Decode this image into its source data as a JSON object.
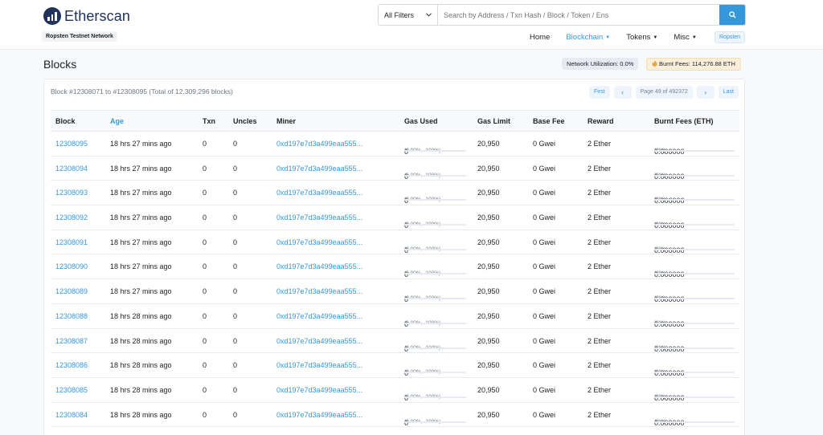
{
  "header": {
    "logo_text": "Etherscan",
    "network_label": "Ropsten Testnet Network",
    "search": {
      "filter_label": "All Filters",
      "placeholder": "Search by Address / Txn Hash / Block / Token / Ens"
    },
    "nav": [
      {
        "label": "Home",
        "active": false,
        "dropdown": false
      },
      {
        "label": "Blockchain",
        "active": true,
        "dropdown": true
      },
      {
        "label": "Tokens",
        "active": false,
        "dropdown": true
      },
      {
        "label": "Misc",
        "active": false,
        "dropdown": true
      }
    ],
    "network_button": "Ropsten"
  },
  "page": {
    "title": "Blocks",
    "network_utilization": "Network Utilization: 0.0%",
    "burnt_fees": "Burnt Fees: 114,276.88 ETH"
  },
  "table": {
    "range_text": "Block #12308071 to #12308095 (Total of 12,309,296 blocks)",
    "pagination": {
      "first": "First",
      "prev": "‹",
      "page_info": "Page 49 of 492372",
      "next": "›",
      "last": "Last"
    },
    "columns": [
      "Block",
      "Age",
      "Txn",
      "Uncles",
      "Miner",
      "Gas Used",
      "Gas Limit",
      "Base Fee",
      "Reward",
      "Burnt Fees (ETH)"
    ],
    "rows": [
      {
        "block": "12308095",
        "age": "18 hrs 27 mins ago",
        "txn": "0",
        "uncles": "0",
        "miner": "0xd197e7d3a499eaa555...",
        "gas_used": "0",
        "gas_pct": "(0.00%, -100%)",
        "gas_limit": "20,950",
        "base_fee": "0 Gwei",
        "reward": "2 Ether",
        "burnt": "0.000000",
        "burnt_pct": "(0%)"
      },
      {
        "block": "12308094",
        "age": "18 hrs 27 mins ago",
        "txn": "0",
        "uncles": "0",
        "miner": "0xd197e7d3a499eaa555...",
        "gas_used": "0",
        "gas_pct": "(0.00%, -100%)",
        "gas_limit": "20,950",
        "base_fee": "0 Gwei",
        "reward": "2 Ether",
        "burnt": "0.000000",
        "burnt_pct": "(0%)"
      },
      {
        "block": "12308093",
        "age": "18 hrs 27 mins ago",
        "txn": "0",
        "uncles": "0",
        "miner": "0xd197e7d3a499eaa555...",
        "gas_used": "0",
        "gas_pct": "(0.00%, -100%)",
        "gas_limit": "20,950",
        "base_fee": "0 Gwei",
        "reward": "2 Ether",
        "burnt": "0.000000",
        "burnt_pct": "(0%)"
      },
      {
        "block": "12308092",
        "age": "18 hrs 27 mins ago",
        "txn": "0",
        "uncles": "0",
        "miner": "0xd197e7d3a499eaa555...",
        "gas_used": "0",
        "gas_pct": "(0.00%, -100%)",
        "gas_limit": "20,950",
        "base_fee": "0 Gwei",
        "reward": "2 Ether",
        "burnt": "0.000000",
        "burnt_pct": "(0%)"
      },
      {
        "block": "12308091",
        "age": "18 hrs 27 mins ago",
        "txn": "0",
        "uncles": "0",
        "miner": "0xd197e7d3a499eaa555...",
        "gas_used": "0",
        "gas_pct": "(0.00%, -100%)",
        "gas_limit": "20,950",
        "base_fee": "0 Gwei",
        "reward": "2 Ether",
        "burnt": "0.000000",
        "burnt_pct": "(0%)"
      },
      {
        "block": "12308090",
        "age": "18 hrs 27 mins ago",
        "txn": "0",
        "uncles": "0",
        "miner": "0xd197e7d3a499eaa555...",
        "gas_used": "0",
        "gas_pct": "(0.00%, -100%)",
        "gas_limit": "20,950",
        "base_fee": "0 Gwei",
        "reward": "2 Ether",
        "burnt": "0.000000",
        "burnt_pct": "(0%)"
      },
      {
        "block": "12308089",
        "age": "18 hrs 27 mins ago",
        "txn": "0",
        "uncles": "0",
        "miner": "0xd197e7d3a499eaa555...",
        "gas_used": "0",
        "gas_pct": "(0.00%, -100%)",
        "gas_limit": "20,950",
        "base_fee": "0 Gwei",
        "reward": "2 Ether",
        "burnt": "0.000000",
        "burnt_pct": "(0%)"
      },
      {
        "block": "12308088",
        "age": "18 hrs 28 mins ago",
        "txn": "0",
        "uncles": "0",
        "miner": "0xd197e7d3a499eaa555...",
        "gas_used": "0",
        "gas_pct": "(0.00%, -100%)",
        "gas_limit": "20,950",
        "base_fee": "0 Gwei",
        "reward": "2 Ether",
        "burnt": "0.000000",
        "burnt_pct": "(0%)"
      },
      {
        "block": "12308087",
        "age": "18 hrs 28 mins ago",
        "txn": "0",
        "uncles": "0",
        "miner": "0xd197e7d3a499eaa555...",
        "gas_used": "0",
        "gas_pct": "(0.00%, -100%)",
        "gas_limit": "20,950",
        "base_fee": "0 Gwei",
        "reward": "2 Ether",
        "burnt": "0.000000",
        "burnt_pct": "(0%)"
      },
      {
        "block": "12308086",
        "age": "18 hrs 28 mins ago",
        "txn": "0",
        "uncles": "0",
        "miner": "0xd197e7d3a499eaa555...",
        "gas_used": "0",
        "gas_pct": "(0.00%, -100%)",
        "gas_limit": "20,950",
        "base_fee": "0 Gwei",
        "reward": "2 Ether",
        "burnt": "0.000000",
        "burnt_pct": "(0%)"
      },
      {
        "block": "12308085",
        "age": "18 hrs 28 mins ago",
        "txn": "0",
        "uncles": "0",
        "miner": "0xd197e7d3a499eaa555...",
        "gas_used": "0",
        "gas_pct": "(0.00%, -100%)",
        "gas_limit": "20,950",
        "base_fee": "0 Gwei",
        "reward": "2 Ether",
        "burnt": "0.000000",
        "burnt_pct": "(0%)"
      },
      {
        "block": "12308084",
        "age": "18 hrs 28 mins ago",
        "txn": "0",
        "uncles": "0",
        "miner": "0xd197e7d3a499eaa555...",
        "gas_used": "0",
        "gas_pct": "(0.00%, -100%)",
        "gas_limit": "20,950",
        "base_fee": "0 Gwei",
        "reward": "2 Ether",
        "burnt": "0.000000",
        "burnt_pct": "(0%)"
      }
    ]
  },
  "colors": {
    "accent": "#3498db",
    "brand_dark": "#21325b",
    "border": "#e7eaf3"
  },
  "icons": {
    "logo": "etherscan-logo-icon",
    "search": "search-icon",
    "filter_caret": "chevron-down-icon",
    "burnt_fees": "flame-icon"
  }
}
